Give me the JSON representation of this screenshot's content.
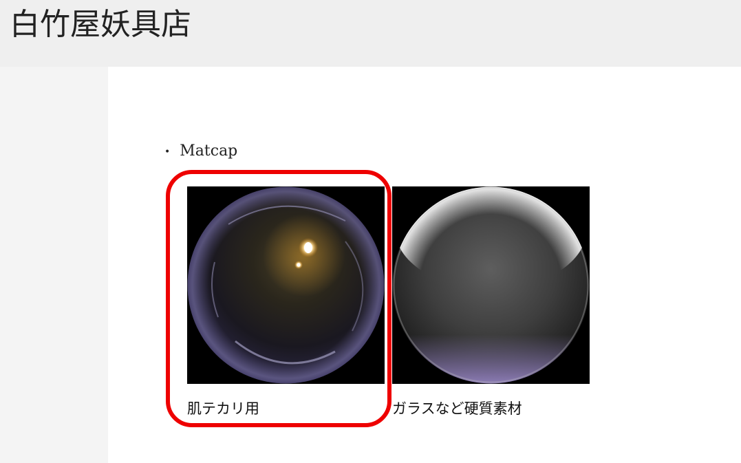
{
  "header": {
    "site_title": "白竹屋妖具店"
  },
  "main": {
    "section_label": "Matcap",
    "bullet_glyph": "•",
    "matcaps": [
      {
        "caption": "肌テカリ用",
        "icon": "skin-gloss-matcap-image",
        "tint": "#5a5480"
      },
      {
        "caption": "ガラスなど硬質素材",
        "icon": "glass-hard-material-matcap-image",
        "tint": "#9a88c8"
      }
    ]
  },
  "annotation": {
    "highlight_color": "#ee0000"
  }
}
